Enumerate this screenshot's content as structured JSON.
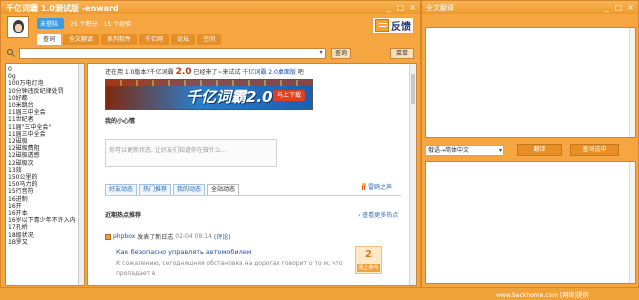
{
  "main_window": {
    "title": "千亿词霸 1.0测试版 -enward",
    "controls": [
      "_",
      "□",
      "×"
    ]
  },
  "user": {
    "badge": "未登陆",
    "points": "25 个积分",
    "experience": "15 个经验"
  },
  "feedback": {
    "label": "反馈"
  },
  "nav": {
    "tabs": [
      {
        "label": "查词",
        "active": true
      },
      {
        "label": "全文翻译"
      },
      {
        "label": "系列软件"
      },
      {
        "label": "千亿网"
      },
      {
        "label": "论坛"
      },
      {
        "label": "空间"
      }
    ]
  },
  "search": {
    "value": "",
    "dropdown": "▾",
    "button": "查询",
    "menu": "菜单"
  },
  "word_list": [
    "0",
    "0g",
    "100万电灯泡",
    "10分钟违反纪律处罚",
    "10好都",
    "10米跳台",
    "11届三中全会",
    "11世纪者",
    "11届\"三中全会\"",
    "11届三中全会",
    "12磁极",
    "12磁极费阻",
    "12磁极透感",
    "12磁极次",
    "13效",
    "150公里的",
    "150马力的",
    "15行音符",
    "16进制",
    "16开",
    "16开本",
    "16岁以下青少年不许入内",
    "17孔桥",
    "18级状况",
    "1B罗又"
  ],
  "content": {
    "promo": {
      "prefix": "还在用 1.0版本?千亿词霸",
      "version": "2.0",
      "middle": "已经来了~来试试",
      "link": "千亿词霸 2.0桌面版",
      "suffix": "吧"
    },
    "banner": {
      "title": "千亿词霸2.0",
      "cta": "马上下载"
    },
    "mood_title": "我的小心情",
    "status_placeholder": "你可以更新状态, 让好友们知道你在做什么...",
    "feed_tabs": [
      {
        "label": "好友动态"
      },
      {
        "label": "热门推荐"
      },
      {
        "label": "我的动态"
      },
      {
        "label": "全站动态",
        "active": true
      }
    ],
    "ribbon_link": "雷鸥之声",
    "hot_title": "近期热点推荐",
    "hot_more": "› 查看更多热点",
    "post": {
      "user": "phpbox",
      "action": "发表了新日志",
      "time": "02-04 08:14",
      "comment": "(评论)",
      "title": "Как безопасно управлять автомобилем",
      "excerpt": "К сожалению, сегодняшняя обстановка на дорогах говорит о то м, что пропадает в",
      "votes": "2",
      "vote_button": "我上参与"
    }
  },
  "translate_window": {
    "title": "全文翻译",
    "controls": [
      "_",
      "□",
      "×"
    ],
    "language": "俄语→简体中文",
    "translate_button": "翻译",
    "lookup_button": "查词选中"
  },
  "watermark": "www.backhome.com [网络]提供"
}
